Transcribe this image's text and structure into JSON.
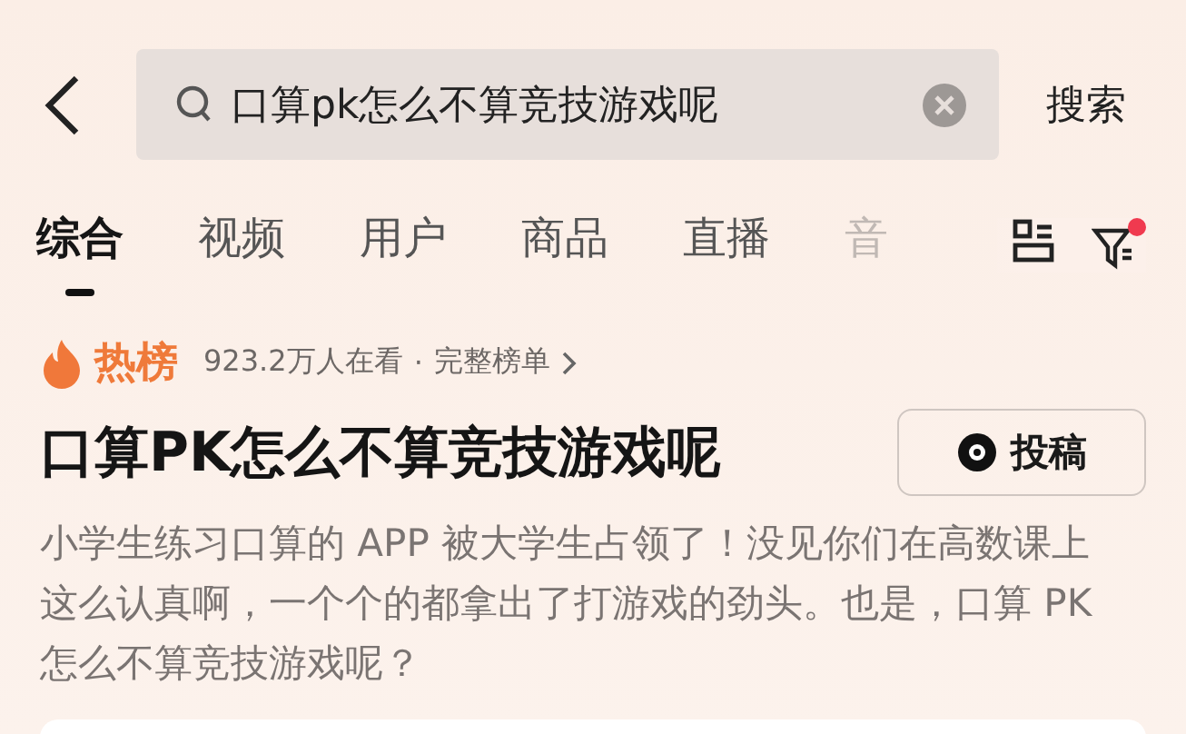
{
  "search": {
    "value": "口算pk怎么不算竞技游戏呢",
    "submit": "搜索"
  },
  "tabs": [
    {
      "label": "综合",
      "selected": true
    },
    {
      "label": "视频",
      "selected": false
    },
    {
      "label": "用户",
      "selected": false
    },
    {
      "label": "商品",
      "selected": false
    },
    {
      "label": "直播",
      "selected": false
    },
    {
      "label": "音",
      "selected": false
    }
  ],
  "filter": {
    "has_notification": true
  },
  "hot": {
    "badge": "热榜",
    "viewers": "923.2万人在看",
    "separator": "·",
    "link": "完整榜单"
  },
  "topic": {
    "title": "口算PK怎么不算竞技游戏呢",
    "post_button": "投稿",
    "description": "小学生练习口算的 APP 被大学生占领了！没见你们在高数课上这么认真啊，一个个的都拿出了打游戏的劲头。也是，口算 PK 怎么不算竞技游戏呢？"
  }
}
